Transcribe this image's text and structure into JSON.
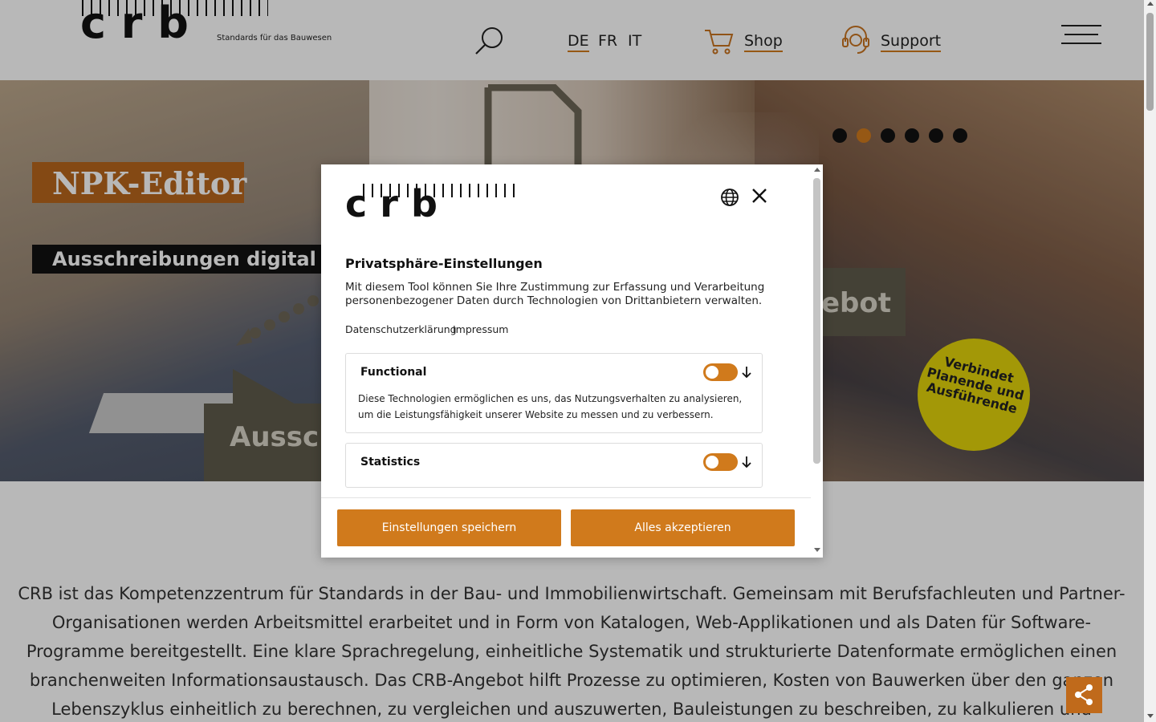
{
  "header": {
    "logo_letters": "c r b",
    "logo_tagline": "Standards für das Bauwesen",
    "languages": [
      "DE",
      "FR",
      "IT"
    ],
    "active_language": "DE",
    "shop_label": "Shop",
    "support_label": "Support"
  },
  "hero": {
    "title": "NPK-Editor",
    "subtitle": "Ausschreibungen digital offer",
    "left_box_text": "Aussch",
    "right_box_text": "ebot",
    "badge_text": "Verbindet Planende und Ausführende",
    "slides_total": 6,
    "active_slide": 2
  },
  "intro_text": "CRB ist das Kompetenzzentrum für Standards in der Bau- und Immobilienwirtschaft. Gemeinsam mit Berufsfachleuten und Partner-Organisationen werden Arbeitsmittel erarbeitet und in Form von Katalogen, Web-Applikationen und als Daten für Software-Programme bereitgestellt. Eine klare Sprachregelung, einheitliche Systematik und strukturierte Datenformate ermöglichen einen branchenweiten Informationsaustausch. Das CRB-Angebot hilft Prozesse zu optimieren, Kosten von Bauwerken über den ganzen Lebenszyklus einheitlich zu berechnen, zu vergleichen und auszuwerten, Bauleistungen zu beschreiben, zu kalkulieren und abzurechnen sowie Farben und",
  "consent": {
    "logo_letters": "c r b",
    "title": "Privatsphäre-Einstellungen",
    "description": "Mit diesem Tool können Sie Ihre Zustimmung zur Erfassung und Verarbeitung personenbezogener Daten durch Technologien von Drittanbietern verwalten.",
    "links": [
      "Datenschutzerklärung",
      "Impressum"
    ],
    "categories": [
      {
        "title": "Functional",
        "description": "Diese Technologien ermöglichen es uns, das Nutzungsverhalten zu analysieren, um die Leistungsfähigkeit unserer Website zu messen und zu verbessern."
      },
      {
        "title": "Statistics",
        "description": ""
      }
    ],
    "save_button": "Einstellungen speichern",
    "accept_button": "Alles akzeptieren"
  },
  "colors": {
    "accent": "#d07a1c",
    "badge": "#e2d30b",
    "hero_grey": "#5f5a4c"
  },
  "icons": [
    "search-icon",
    "cart-icon",
    "headset-icon",
    "hamburger-menu-icon",
    "globe-icon",
    "close-icon",
    "arrow-down-icon",
    "share-icon"
  ]
}
